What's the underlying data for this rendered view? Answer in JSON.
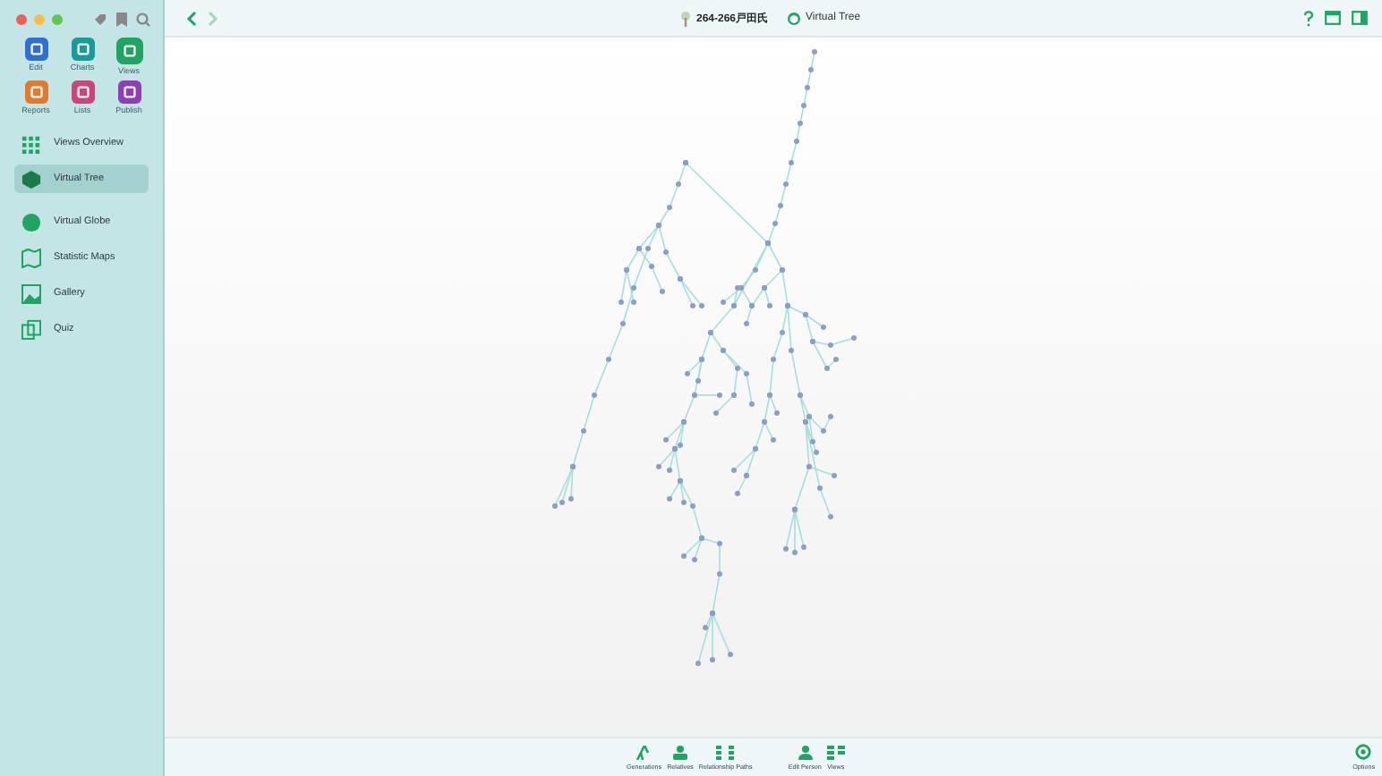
{
  "sidebar": {
    "tools": [
      {
        "label": "Edit",
        "color": "#2f6fd1",
        "selected": false
      },
      {
        "label": "Charts",
        "color": "#1a9a9a",
        "selected": false
      },
      {
        "label": "Views",
        "color": "#1fa463",
        "selected": true
      },
      {
        "label": "Reports",
        "color": "#e07a2e",
        "selected": false
      },
      {
        "label": "Lists",
        "color": "#c9457a",
        "selected": false
      },
      {
        "label": "Publish",
        "color": "#8e3fb8",
        "selected": false
      }
    ],
    "items": [
      {
        "label": "Views Overview",
        "kind": "grid",
        "selected": false
      },
      {
        "label": "Virtual Tree",
        "kind": "cube",
        "selected": true
      },
      {
        "label": "Virtual Globe",
        "kind": "globe",
        "selected": false
      },
      {
        "label": "Statistic Maps",
        "kind": "map",
        "selected": false
      },
      {
        "label": "Gallery",
        "kind": "picture",
        "selected": false
      },
      {
        "label": "Quiz",
        "kind": "cards",
        "selected": false
      }
    ]
  },
  "title_bar": {
    "tree_name": "264-266戸田氏",
    "view_name": "Virtual Tree"
  },
  "toolbar": {
    "buttons": [
      {
        "label": "Generations",
        "kind": "generations"
      },
      {
        "label": "Relatives",
        "kind": "relatives"
      },
      {
        "label": "Relationship Paths",
        "kind": "paths"
      },
      {
        "label": "Edit Person",
        "kind": "person"
      },
      {
        "label": "Views",
        "kind": "views"
      }
    ],
    "options": "Options"
  }
}
